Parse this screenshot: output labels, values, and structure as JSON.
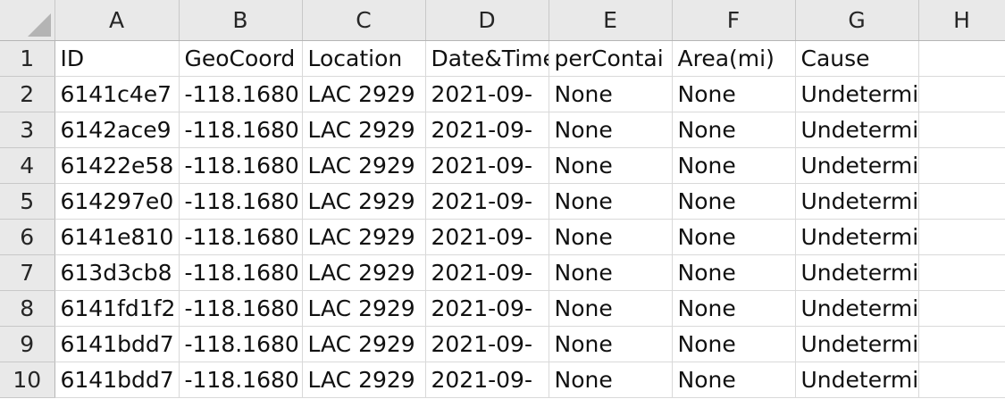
{
  "spreadsheet": {
    "columns": [
      "A",
      "B",
      "C",
      "D",
      "E",
      "F",
      "G",
      "H"
    ],
    "rows": [
      {
        "num": "1",
        "cells": [
          "ID",
          "GeoCoord",
          "Location",
          "Date&Time",
          "perContai",
          "Area(mi)",
          "Cause",
          ""
        ]
      },
      {
        "num": "2",
        "cells": [
          "6141c4e7",
          "-118.1680",
          "LAC 2929",
          "2021-09-",
          "None",
          "None",
          "Undetermined",
          ""
        ]
      },
      {
        "num": "3",
        "cells": [
          "6142ace9",
          "-118.1680",
          "LAC 2929",
          "2021-09-",
          "None",
          "None",
          "Undetermined",
          ""
        ]
      },
      {
        "num": "4",
        "cells": [
          "61422e58",
          "-118.1680",
          "LAC 2929",
          "2021-09-",
          "None",
          "None",
          "Undetermined",
          ""
        ]
      },
      {
        "num": "5",
        "cells": [
          "614297e0",
          "-118.1680",
          "LAC 2929",
          "2021-09-",
          "None",
          "None",
          "Undetermined",
          ""
        ]
      },
      {
        "num": "6",
        "cells": [
          "6141e810",
          "-118.1680",
          "LAC 2929",
          "2021-09-",
          "None",
          "None",
          "Undetermined",
          ""
        ]
      },
      {
        "num": "7",
        "cells": [
          "613d3cb8",
          "-118.1680",
          "LAC 2929",
          "2021-09-",
          "None",
          "None",
          "Undetermined",
          ""
        ]
      },
      {
        "num": "8",
        "cells": [
          "6141fd1f2",
          "-118.1680",
          "LAC 2929",
          "2021-09-",
          "None",
          "None",
          "Undetermined",
          ""
        ]
      },
      {
        "num": "9",
        "cells": [
          "6141bdd7",
          "-118.1680",
          "LAC 2929",
          "2021-09-",
          "None",
          "None",
          "Undetermined",
          ""
        ]
      },
      {
        "num": "10",
        "cells": [
          "6141bdd7",
          "-118.1680",
          "LAC 2929",
          "2021-09-",
          "None",
          "None",
          "Undetermined",
          ""
        ]
      }
    ]
  },
  "colors": {
    "header_bg": "#e9e9e9",
    "gridline": "#d9d9d9"
  }
}
